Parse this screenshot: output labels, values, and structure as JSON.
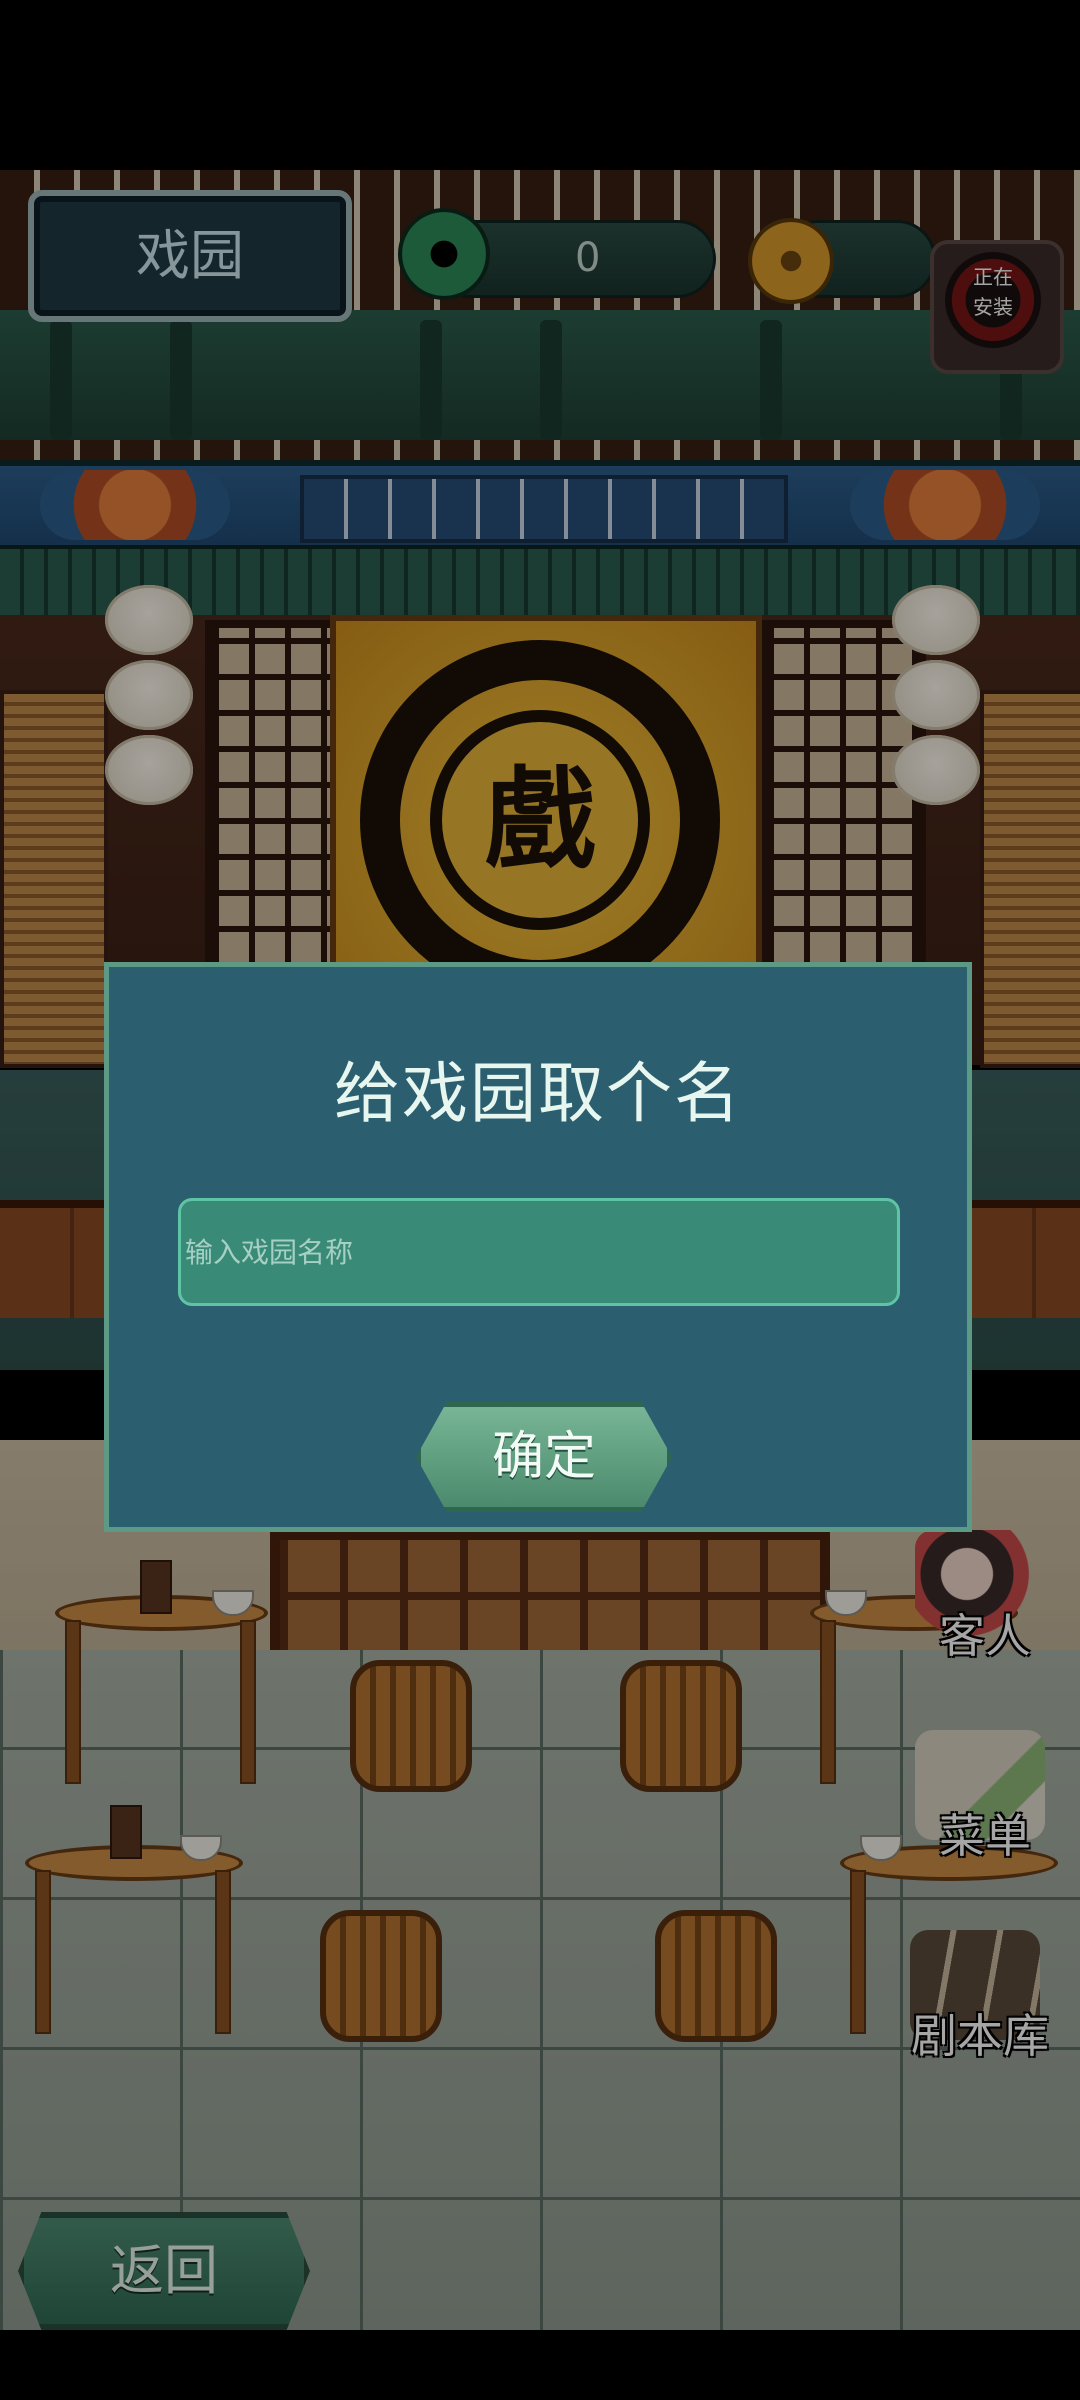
{
  "hud": {
    "venue_label": "戏园",
    "jade_amount": "0",
    "coin_amount": "",
    "install_badge": {
      "line1": "正在",
      "line2": "安装"
    }
  },
  "scene": {
    "sign_char": "戲"
  },
  "dialog": {
    "title": "给戏园取个名",
    "input_placeholder": "输入戏园名称",
    "input_value": "",
    "confirm_label": "确定"
  },
  "side_menu": [
    {
      "label": "客人"
    },
    {
      "label": "菜单"
    },
    {
      "label": "剧本库"
    }
  ],
  "back_label": "返回",
  "colors": {
    "dialog_bg": "#2b5f6f",
    "input_bg": "#3a8a78",
    "button_green": "#4c8a6d"
  }
}
